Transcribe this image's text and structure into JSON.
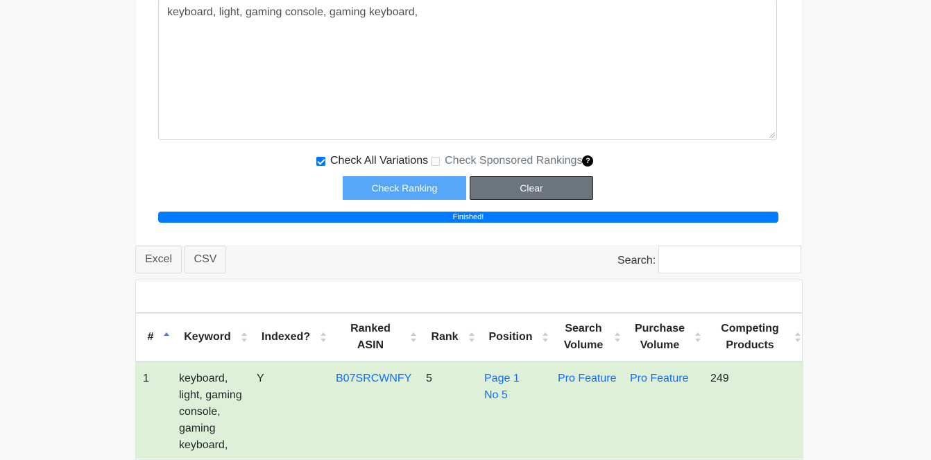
{
  "keywords_input": {
    "value": "keyboard, light, gaming console, gaming keyboard,"
  },
  "options": {
    "check_all_variations": {
      "label": "Check All Variations",
      "checked": true
    },
    "check_sponsored": {
      "label": "Check Sponsored Rankings",
      "checked": false
    }
  },
  "buttons": {
    "check_ranking": "Check Ranking",
    "clear": "Clear"
  },
  "progress": {
    "text": "Finished!",
    "value": 1.0
  },
  "export": {
    "excel": "Excel",
    "csv": "CSV"
  },
  "search": {
    "label": "Search:",
    "value": ""
  },
  "table": {
    "headers": {
      "num": "#",
      "keyword": "Keyword",
      "indexed": "Indexed?",
      "ranked_asin_1": "Ranked",
      "ranked_asin_2": "ASIN",
      "rank": "Rank",
      "position": "Position",
      "search_volume_1": "Search",
      "search_volume_2": "Volume",
      "purchase_volume_1": "Purchase",
      "purchase_volume_2": "Volume",
      "competing_1": "Competing",
      "competing_2": "Products"
    },
    "rows": [
      {
        "num": "1",
        "keyword": "keyboard, light, gaming console, gaming keyboard,",
        "indexed": "Y",
        "asin": "B07SRCWNFY",
        "rank": "5",
        "position_1": "Page 1",
        "position_2": "No 5",
        "search_volume": "Pro Feature",
        "purchase_volume": "Pro Feature",
        "competing": "249"
      }
    ]
  },
  "colors": {
    "accent": "#007bff",
    "row_highlight": "#dff0d8",
    "check_btn": "#56a7f9",
    "clear_btn": "#6c757d"
  }
}
